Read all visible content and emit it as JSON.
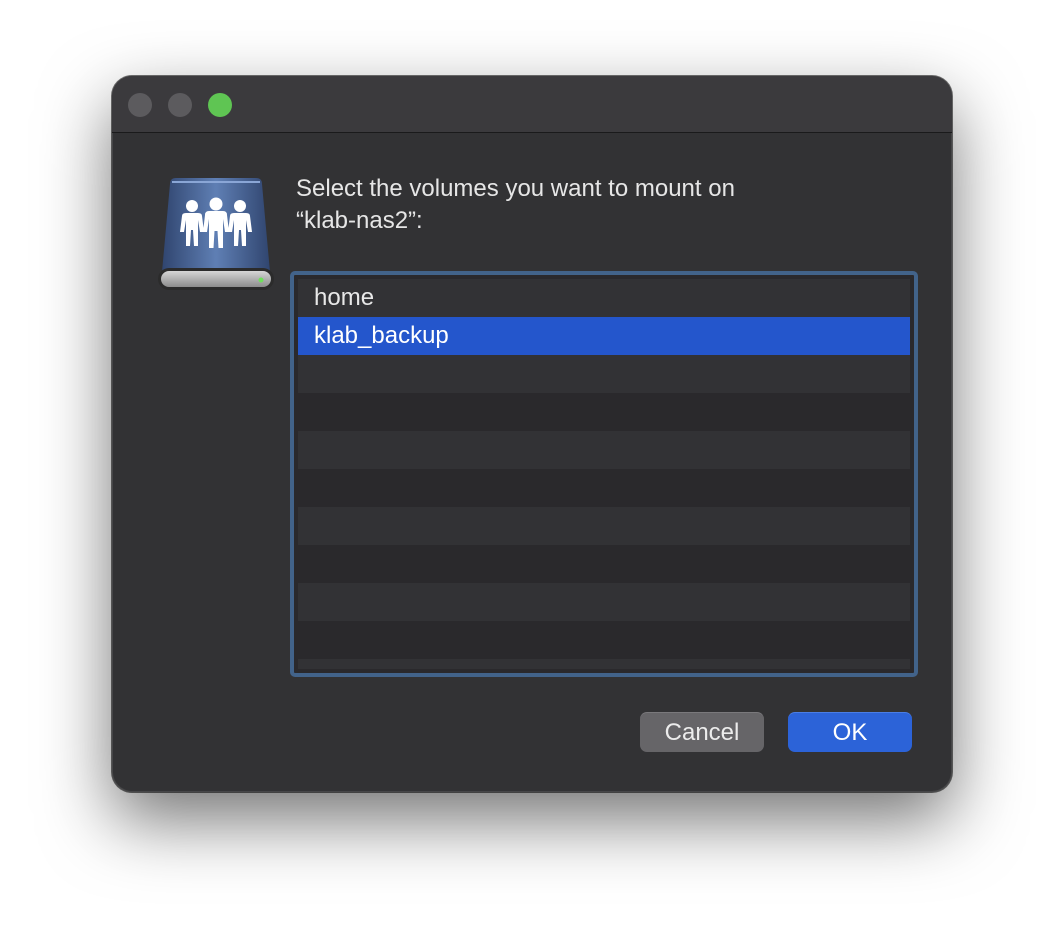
{
  "window": {
    "traffic_lights": [
      "close",
      "minimize",
      "zoom"
    ]
  },
  "dialog": {
    "icon": "shared-server-icon",
    "prompt_line1": "Select the volumes you want to mount on",
    "prompt_line2": "“klab-nas2”:"
  },
  "volumes": {
    "items": [
      {
        "label": "home",
        "selected": false
      },
      {
        "label": "klab_backup",
        "selected": true
      }
    ]
  },
  "buttons": {
    "cancel_label": "Cancel",
    "ok_label": "OK"
  },
  "colors": {
    "window_bg": "#323234",
    "selection": "#2456cc",
    "focus_ring": "#42638a",
    "ok_button": "#2c63d8",
    "zoom_light": "#5fc553"
  }
}
